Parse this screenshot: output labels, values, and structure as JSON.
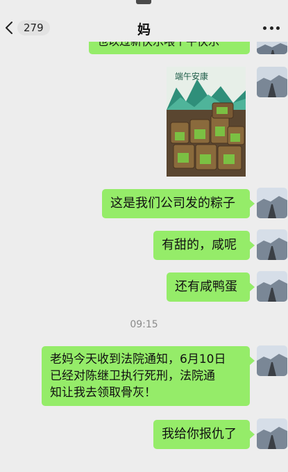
{
  "header": {
    "unread_count": "279",
    "title": "妈"
  },
  "messages": {
    "top_partial": "也以过新快乐喂个平快乐",
    "photo": {
      "banner_text": "端午安康",
      "icon": "zongzi-gift-photo"
    },
    "m1": "这是我们公司发的粽子",
    "m2": "有甜的，咸呢",
    "m3": "还有咸鸭蛋",
    "timestamp": "09:15",
    "m4_line1": "老妈今天收到法院通知，6月10日",
    "m4_line2": "已经对陈继卫执行死刑，法院通",
    "m4_line3": "知让我去领取骨灰！",
    "m5": "我给你报仇了"
  },
  "colors": {
    "bubble": "#95ec69",
    "background": "#ededed",
    "timestamp": "#8a8a8a"
  }
}
